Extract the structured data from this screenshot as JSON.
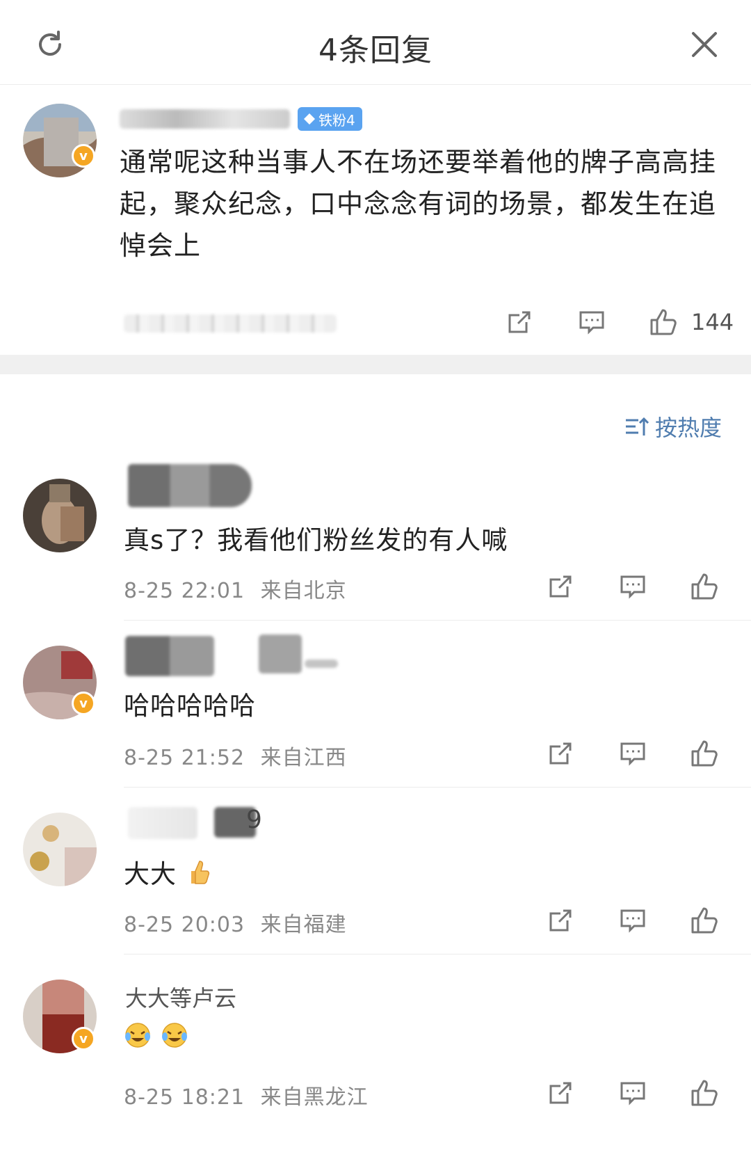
{
  "header": {
    "title": "4条回复",
    "refresh_icon": "refresh-icon",
    "close_icon": "close-icon"
  },
  "root_comment": {
    "username": "…",
    "fan_badge": "铁粉4",
    "text": "通常呢这种当事人不在场还要举着他的牌子高高挂起，聚众纪念，口中念念有词的场景，都发生在追悼会上",
    "likes": "144"
  },
  "sort": {
    "label": "按热度"
  },
  "replies": [
    {
      "text": "真s了？我看他们粉丝发的有人喊",
      "time": "8-25 22:01",
      "location": "来自北京",
      "verified": false
    },
    {
      "text": "哈哈哈哈哈",
      "time": "8-25 21:52",
      "location": "来自江西",
      "verified": true
    },
    {
      "username_suffix": "9",
      "text": "大大",
      "emoji": "thumbs-up",
      "time": "8-25 20:03",
      "location": "来自福建",
      "verified": false
    },
    {
      "username": "大大等卢云",
      "text": "",
      "emoji": "laughing-crying x2",
      "time": "8-25 18:21",
      "location": "来自黑龙江",
      "verified": true
    }
  ],
  "colors": {
    "accent": "#507daf",
    "badge": "#5aa3f0",
    "verified": "#f5a623",
    "separator": "#f0f0f0"
  }
}
